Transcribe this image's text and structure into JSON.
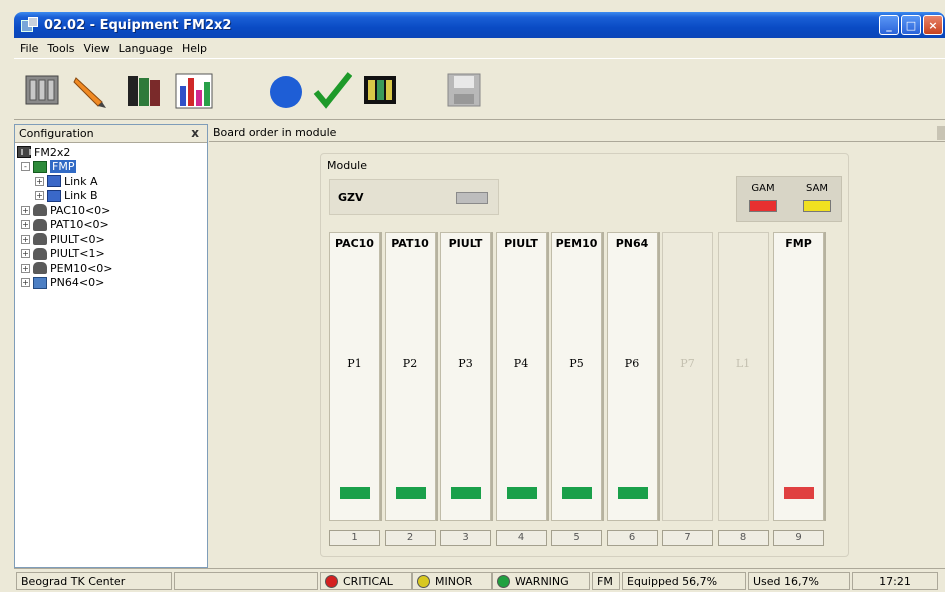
{
  "window": {
    "title": "02.02 - Equipment FM2x2"
  },
  "menu": [
    "File",
    "Tools",
    "View",
    "Language",
    "Help"
  ],
  "toolbar": {
    "buttons": [
      "rack-icon",
      "pen-icon",
      "binders-icon",
      "bar-chart-icon",
      "circle-icon",
      "checkmark-icon",
      "slots-icon",
      "save-icon"
    ]
  },
  "left_panel": {
    "title": "Configuration",
    "close_glyph": "x",
    "tree": [
      {
        "label": "FM2x2",
        "level": 0,
        "icon": "rack-icon",
        "expander": ""
      },
      {
        "label": "FMP",
        "level": 1,
        "icon": "board-icon",
        "expander": "-",
        "selected": true
      },
      {
        "label": "Link A",
        "level": 2,
        "icon": "link-icon",
        "expander": "+"
      },
      {
        "label": "Link B",
        "level": 2,
        "icon": "link-icon",
        "expander": "+"
      },
      {
        "label": "PAC10<0>",
        "level": 1,
        "icon": "phone-icon",
        "expander": "+"
      },
      {
        "label": "PAT10<0>",
        "level": 1,
        "icon": "phone-icon",
        "expander": "+"
      },
      {
        "label": "PIULT<0>",
        "level": 1,
        "icon": "phone-icon",
        "expander": "+"
      },
      {
        "label": "PIULT<1>",
        "level": 1,
        "icon": "phone-icon",
        "expander": "+"
      },
      {
        "label": "PEM10<0>",
        "level": 1,
        "icon": "phone-icon",
        "expander": "+"
      },
      {
        "label": "PN64<0>",
        "level": 1,
        "icon": "computer-icon",
        "expander": "+"
      }
    ]
  },
  "main": {
    "title": "Board order in module",
    "module_label": "Module",
    "gzv_label": "GZV",
    "alarms": [
      {
        "label": "GAM",
        "color": "#e83030"
      },
      {
        "label": "SAM",
        "color": "#f0e020"
      }
    ],
    "slots": [
      {
        "name": "PAC10",
        "pos": "P1",
        "filled": true,
        "led": "#1aa04a"
      },
      {
        "name": "PAT10",
        "pos": "P2",
        "filled": true,
        "led": "#1aa04a"
      },
      {
        "name": "PIULT",
        "pos": "P3",
        "filled": true,
        "led": "#1aa04a"
      },
      {
        "name": "PIULT",
        "pos": "P4",
        "filled": true,
        "led": "#1aa04a"
      },
      {
        "name": "PEM10",
        "pos": "P5",
        "filled": true,
        "led": "#1aa04a"
      },
      {
        "name": "PN64",
        "pos": "P6",
        "filled": true,
        "led": "#1aa04a"
      },
      {
        "name": "",
        "pos": "P7",
        "filled": false,
        "led": ""
      },
      {
        "name": "",
        "pos": "L1",
        "filled": false,
        "led": ""
      },
      {
        "name": "FMP",
        "pos": "",
        "filled": true,
        "led": "#e04040"
      }
    ],
    "slot_numbers": [
      "1",
      "2",
      "3",
      "4",
      "5",
      "6",
      "7",
      "8",
      "9"
    ]
  },
  "status_bar": {
    "location": "Beograd TK Center",
    "critical": "CRITICAL",
    "minor": "MINOR",
    "warning": "WARNING",
    "mode": "FM",
    "equipped": "Equipped 56,7%",
    "used": "Used 16,7%",
    "time": "17:21",
    "colors": {
      "critical": "#d42020",
      "minor": "#d8c820",
      "warning": "#20a040"
    }
  }
}
